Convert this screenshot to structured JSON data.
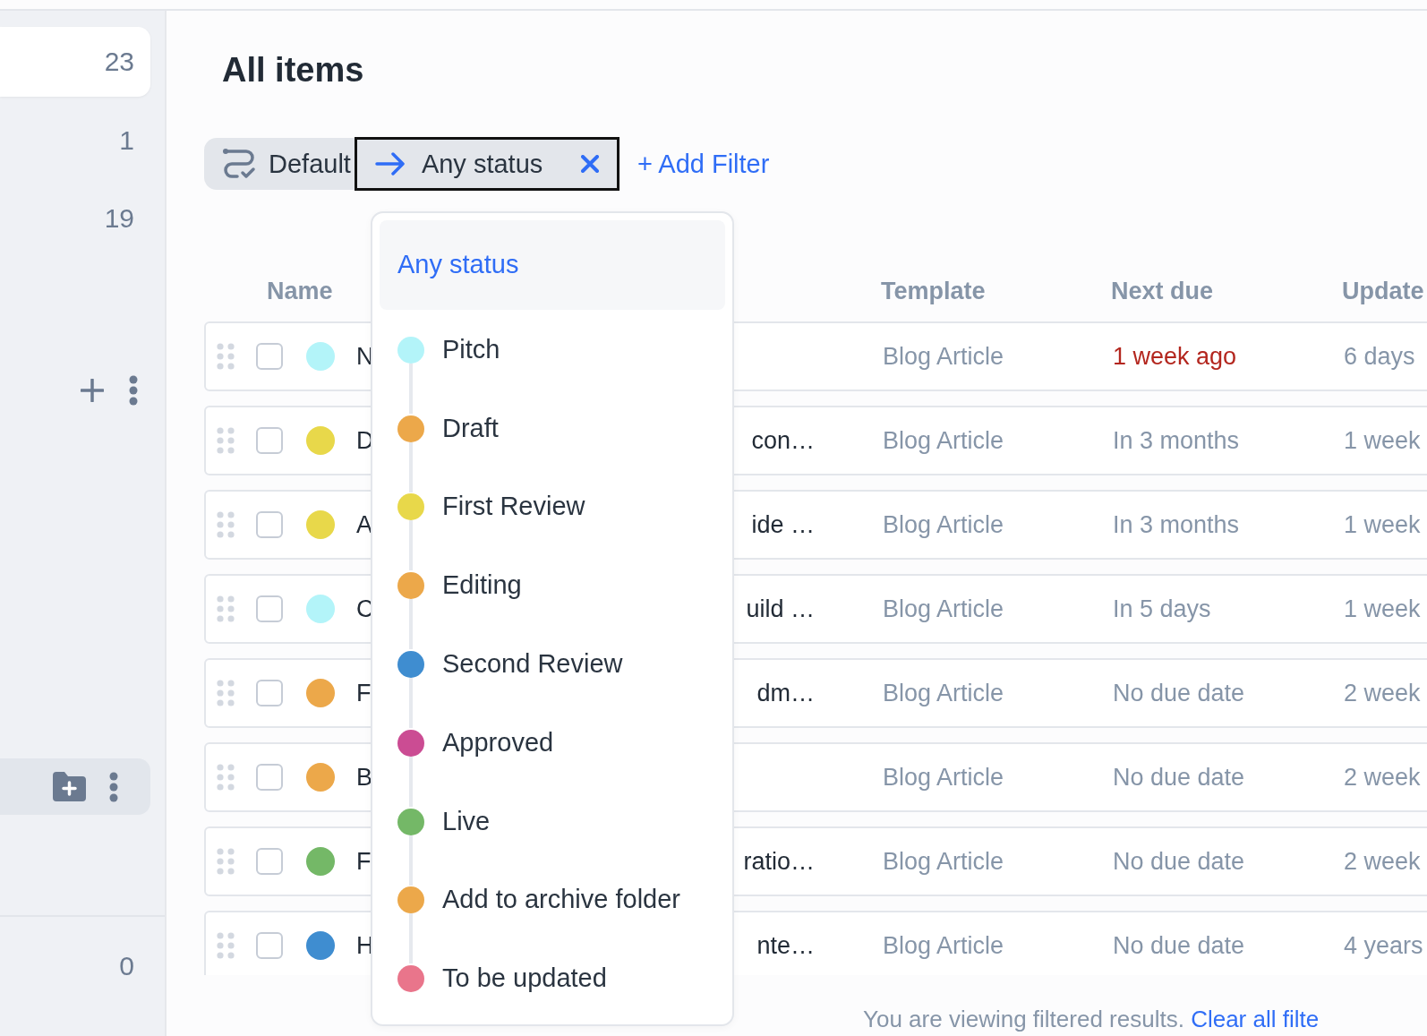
{
  "sidebar": {
    "items": [
      {
        "count": "23",
        "selected": true
      },
      {
        "count": "1",
        "selected": false
      },
      {
        "count": "19",
        "selected": false
      }
    ],
    "bottom_count": "0"
  },
  "page": {
    "title": "All items"
  },
  "filters": {
    "view": "Default",
    "status": "Any status",
    "add_filter": "+ Add Filter"
  },
  "status_menu": {
    "items": [
      {
        "kind": "any",
        "label": "Any status",
        "selected": true
      },
      {
        "kind": "status",
        "label": "Pitch",
        "color": "#b3f4f9",
        "selected": false
      },
      {
        "kind": "status",
        "label": "Draft",
        "color": "#eca84a",
        "selected": false
      },
      {
        "kind": "status",
        "label": "First Review",
        "color": "#e8d84a",
        "selected": false
      },
      {
        "kind": "status",
        "label": "Editing",
        "color": "#eca84a",
        "selected": false
      },
      {
        "kind": "status",
        "label": "Second Review",
        "color": "#3f8dd0",
        "selected": false
      },
      {
        "kind": "status",
        "label": "Approved",
        "color": "#cb4c93",
        "selected": false
      },
      {
        "kind": "status",
        "label": "Live",
        "color": "#74b867",
        "selected": false
      },
      {
        "kind": "status",
        "label": "Add to archive folder",
        "color": "#eca84a",
        "selected": false
      },
      {
        "kind": "status",
        "label": "To be updated",
        "color": "#e9758b",
        "selected": false
      }
    ]
  },
  "table": {
    "columns": [
      "Name",
      "Template",
      "Next due",
      "Update"
    ],
    "rows": [
      {
        "color": "#b3f4f9",
        "checked": false,
        "name_start": "N",
        "name_end": "",
        "template": "Blog Article",
        "next_due": "1 week ago",
        "overdue": true,
        "updated": "6 days"
      },
      {
        "color": "#e8d84a",
        "checked": false,
        "name_start": "D",
        "name_end": "con…",
        "template": "Blog Article",
        "next_due": "In 3 months",
        "overdue": false,
        "updated": "1 week"
      },
      {
        "color": "#e8d84a",
        "checked": false,
        "name_start": "A",
        "name_end": "ide …",
        "template": "Blog Article",
        "next_due": "In 3 months",
        "overdue": false,
        "updated": "1 week"
      },
      {
        "color": "#b3f4f9",
        "checked": false,
        "name_start": "C",
        "name_end": "uild …",
        "template": "Blog Article",
        "next_due": "In 5 days",
        "overdue": false,
        "updated": "1 week"
      },
      {
        "color": "#eca84a",
        "checked": false,
        "name_start": "F",
        "name_end": "dm…",
        "template": "Blog Article",
        "next_due": "No due date",
        "overdue": false,
        "updated": "2 week"
      },
      {
        "color": "#eca84a",
        "checked": false,
        "name_start": "B",
        "name_end": "",
        "template": "Blog Article",
        "next_due": "No due date",
        "overdue": false,
        "updated": "2 week"
      },
      {
        "color": "#74b867",
        "checked": false,
        "name_start": "F",
        "name_end": "ratio…",
        "template": "Blog Article",
        "next_due": "No due date",
        "overdue": false,
        "updated": "2 week"
      },
      {
        "color": "#3f8dd0",
        "checked": false,
        "name_start": "H",
        "name_end": "nte…",
        "template": "Blog Article",
        "next_due": "No due date",
        "overdue": false,
        "updated": "4 years"
      }
    ]
  },
  "footer": {
    "text": "You are viewing filtered results.",
    "link": "Clear all filte"
  }
}
